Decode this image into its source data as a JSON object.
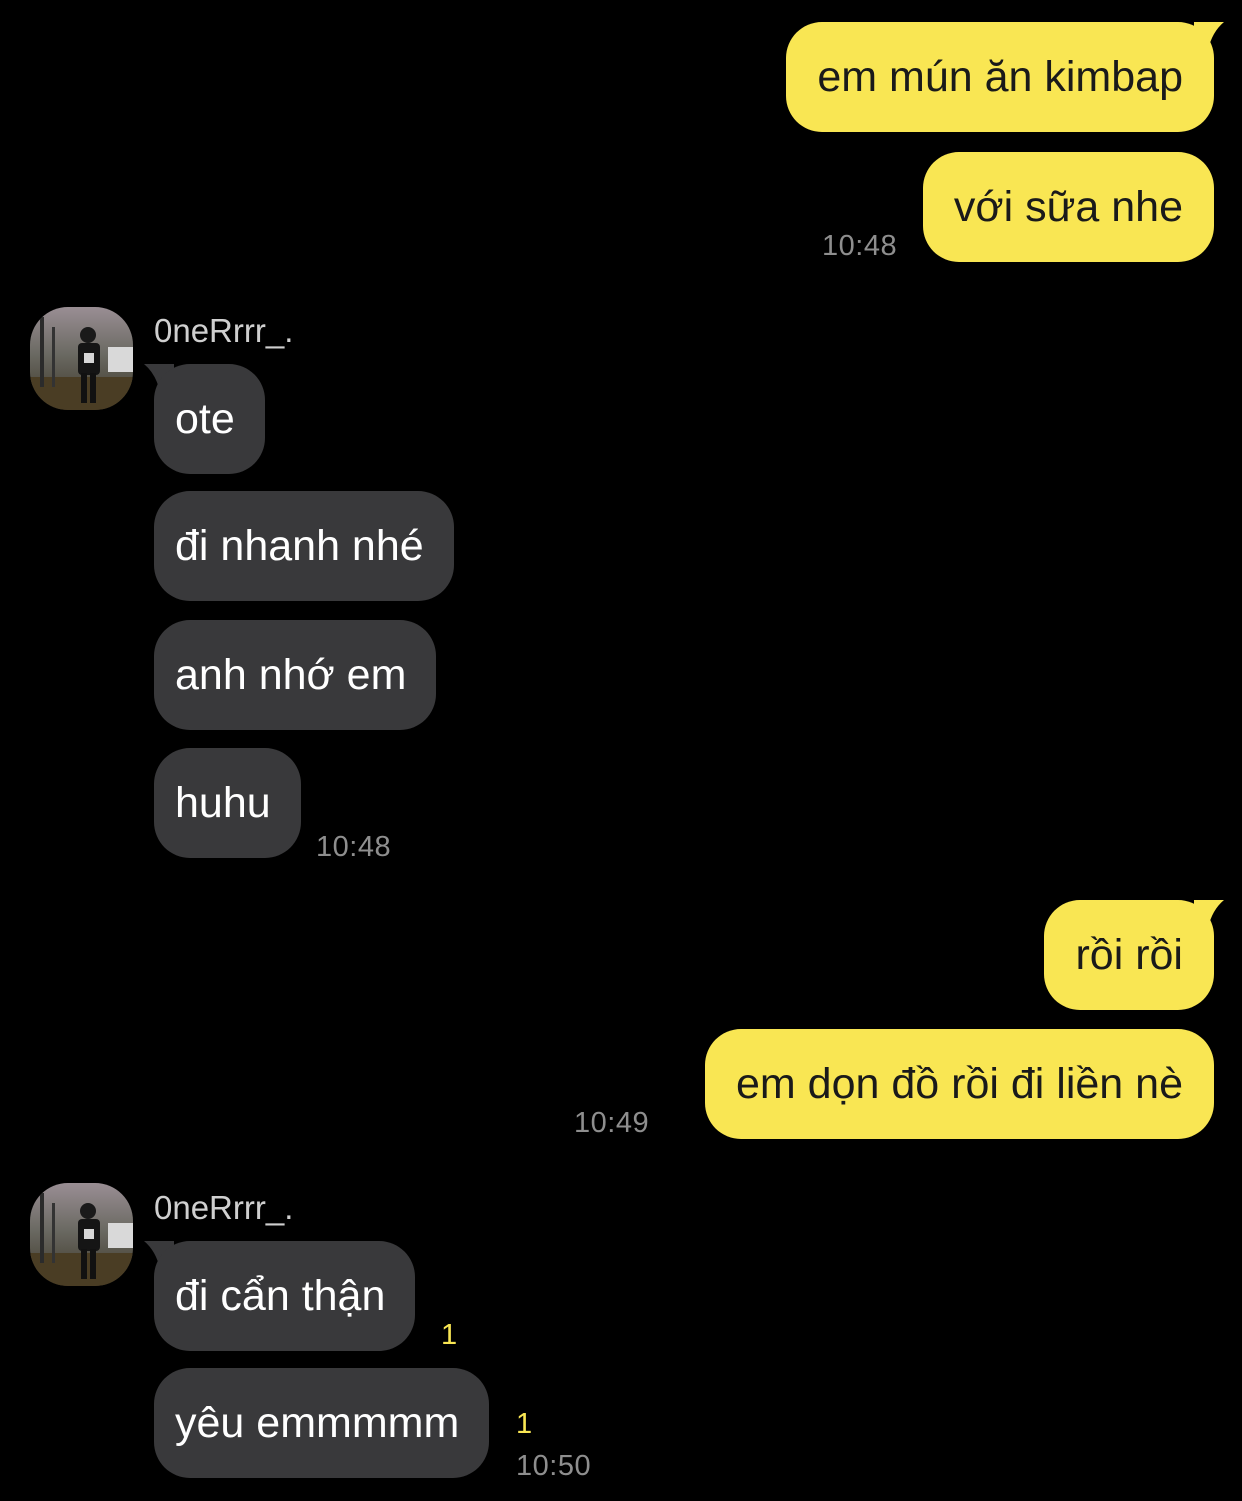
{
  "colors": {
    "background": "#000000",
    "outgoing_bubble": "#F9E653",
    "incoming_bubble": "#39393B",
    "timestamp": "#8E8E8E",
    "unread_count": "#F9E653"
  },
  "chat": {
    "out1": {
      "msg1": "em mún ăn kimbap",
      "msg2": "với sữa nhe",
      "time": "10:48"
    },
    "in1": {
      "sender": "0neRrrr_.",
      "msg1": "ote",
      "msg2": "đi nhanh nhé",
      "msg3": "anh nhớ em",
      "msg4": "huhu",
      "time": "10:48"
    },
    "out2": {
      "msg1": "rồi rồi",
      "msg2": "em dọn đồ rồi đi liền nè",
      "time": "10:49"
    },
    "in2": {
      "sender": "0neRrrr_.",
      "msg1": "đi cẩn thận",
      "msg1_unread": "1",
      "msg2": "yêu emmmmm",
      "msg2_unread": "1",
      "time": "10:50"
    }
  },
  "icons": {
    "avatar": "profile-photo-avatar"
  }
}
